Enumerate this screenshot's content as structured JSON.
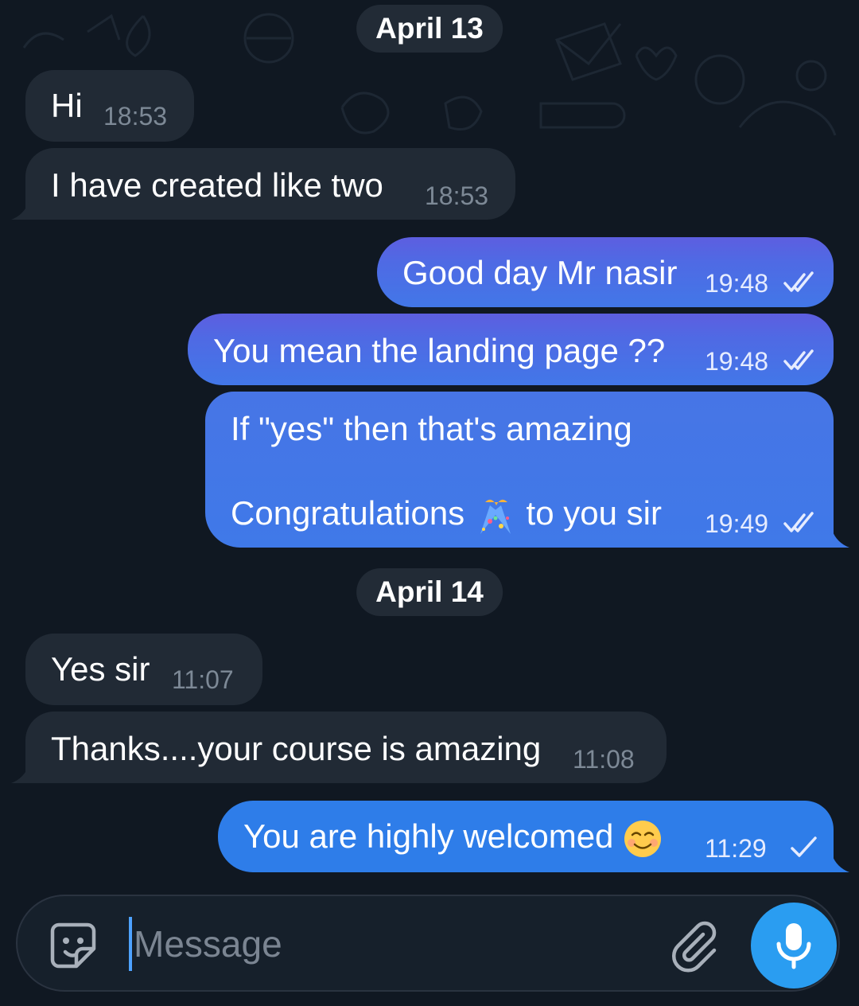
{
  "colors": {
    "background": "#101822",
    "incoming_bubble": "#212a35",
    "outgoing_bubble": "#4f6ae4",
    "mic_button": "#2a9df1"
  },
  "messages_day1": {
    "date_label": "April 13",
    "m1": {
      "text": "Hi",
      "time": "18:53"
    },
    "m2": {
      "text": "I have created like two",
      "time": "18:53"
    },
    "m3": {
      "text": "Good day Mr nasir",
      "time": "19:48",
      "status": "read"
    },
    "m4": {
      "text": "You mean the landing page ??",
      "time": "19:48",
      "status": "read"
    },
    "m5": {
      "line1": "If \"yes\" then that's amazing",
      "line2a": "Congratulations",
      "emoji": "party-popper-icon",
      "line2b": "to you sir",
      "time": "19:49",
      "status": "read"
    }
  },
  "messages_day2": {
    "date_label": "April 14",
    "m6": {
      "text": "Yes sir",
      "time": "11:07"
    },
    "m7": {
      "text": "Thanks....your course is amazing",
      "time": "11:08"
    },
    "m8": {
      "text": "You are highly welcomed",
      "emoji": "smiling-face-icon",
      "time": "11:29",
      "status": "sent"
    }
  },
  "composer": {
    "placeholder": "Message",
    "sticker_icon": "sticker-icon",
    "attach_icon": "paperclip-icon",
    "mic_icon": "microphone-icon"
  }
}
